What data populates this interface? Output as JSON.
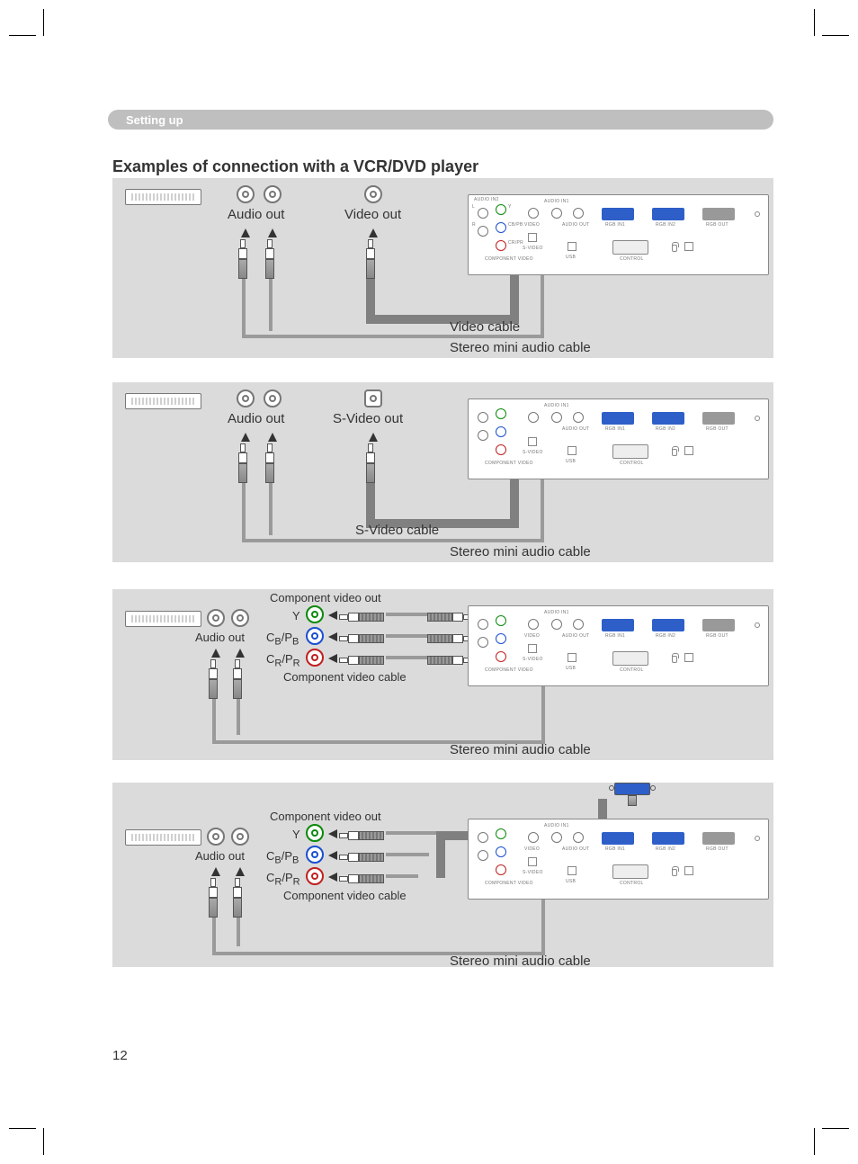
{
  "section_bar": "Setting up",
  "heading": "Examples of connection with a VCR/DVD player",
  "page_number": "12",
  "labels": {
    "audio_out": "Audio out",
    "video_out": "Video out",
    "svideo_out": "S-Video out",
    "component_out": "Component video out",
    "y": "Y",
    "cbpb": "CB/PB",
    "crpr": "CR/PR"
  },
  "cables": {
    "video": "Video cable",
    "svideo": "S-Video cable",
    "stereo_mini": "Stereo mini audio cable",
    "component": "Component video cable"
  },
  "projector_ports": {
    "audio_in1": "AUDIO IN1",
    "audio_in2": "AUDIO IN2",
    "audio_out": "AUDIO OUT",
    "rgb_in1": "RGB IN1",
    "rgb_in2": "RGB IN2",
    "rgb_out": "RGB OUT",
    "component_video": "COMPONENT VIDEO",
    "y": "Y",
    "cbpb": "CB/PB",
    "crpr": "CR/PR",
    "video": "VIDEO",
    "svideo": "S-VIDEO",
    "usb": "USB",
    "control": "CONTROL",
    "l": "L",
    "r": "R"
  }
}
